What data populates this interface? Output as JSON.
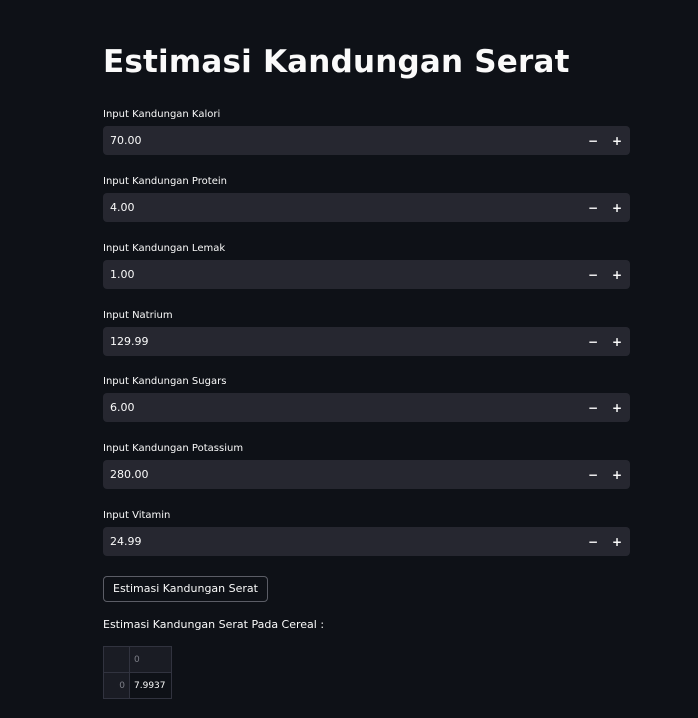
{
  "page": {
    "title": "Estimasi Kandungan Serat"
  },
  "fields": [
    {
      "label": "Input Kandungan Kalori",
      "value": "70.00"
    },
    {
      "label": "Input Kandungan Protein",
      "value": "4.00"
    },
    {
      "label": "Input Kandungan Lemak",
      "value": "1.00"
    },
    {
      "label": "Input Natrium",
      "value": "129.99"
    },
    {
      "label": "Input Kandungan Sugars",
      "value": "6.00"
    },
    {
      "label": "Input Kandungan Potassium",
      "value": "280.00"
    },
    {
      "label": "Input Vitamin",
      "value": "24.99"
    }
  ],
  "stepper": {
    "minus": "−",
    "plus": "+"
  },
  "action": {
    "label": "Estimasi Kandungan Serat"
  },
  "result": {
    "label": "Estimasi Kandungan Serat Pada Cereal :",
    "table": {
      "column_header": "0",
      "rows": [
        {
          "index": "0",
          "value": "7.9937"
        }
      ]
    }
  },
  "colors": {
    "background": "#0e1117",
    "input_background": "#262730",
    "text": "#fafafa"
  }
}
